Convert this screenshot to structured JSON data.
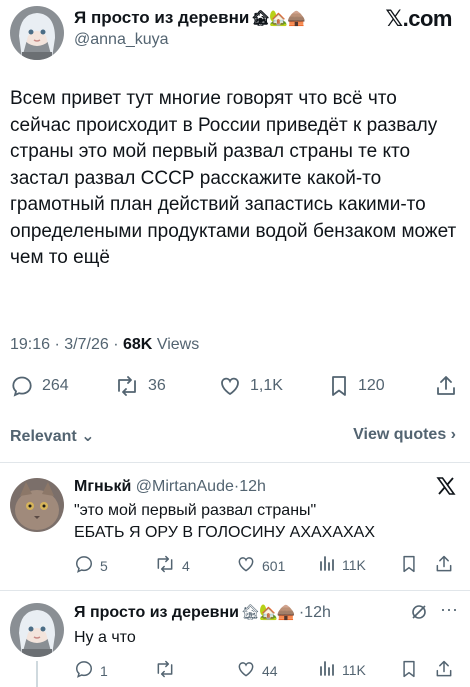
{
  "main_tweet": {
    "author_name": "Я просто из деревни",
    "author_emoji": "🏚🏡🛖",
    "handle": "@anna_kuya",
    "brand": "𝕏.com",
    "text": "Всем привет тут многие говорят что всё что сейчас происходит в России приведёт к развалу страны это мой первый развал страны те кто застал развал СССР расскажите какой-то грамотный план действий запастись какими-то определеными продуктами водой бензаком может чем то ещё",
    "time": "19:16",
    "date": "3/7/26",
    "views_count": "68K",
    "views_label": "Views",
    "replies": "264",
    "reposts": "36",
    "likes": "1,1K",
    "bookmarks": "120"
  },
  "sort": {
    "label": "Relevant",
    "view_quotes": "View quotes"
  },
  "replies": [
    {
      "name": "Мгнькй",
      "handle": "@MirtanAude",
      "age": "12h",
      "line1": "\"это мой первый развал страны\"",
      "line2": "ЕБАТЬ Я ОРУ В ГОЛОСИНУ АХАХАХАХ",
      "replies": "5",
      "reposts": "4",
      "likes": "601",
      "views": "11K"
    },
    {
      "name": "Я просто из деревни",
      "emoji": "🏚🏡🛖",
      "age": "12h",
      "line1": "Ну а что",
      "replies": "1",
      "reposts": "",
      "likes": "44",
      "views": "11K"
    }
  ],
  "colors": {
    "text": "#0f1419",
    "secondary": "#536471",
    "divider": "#e1e6ea"
  }
}
